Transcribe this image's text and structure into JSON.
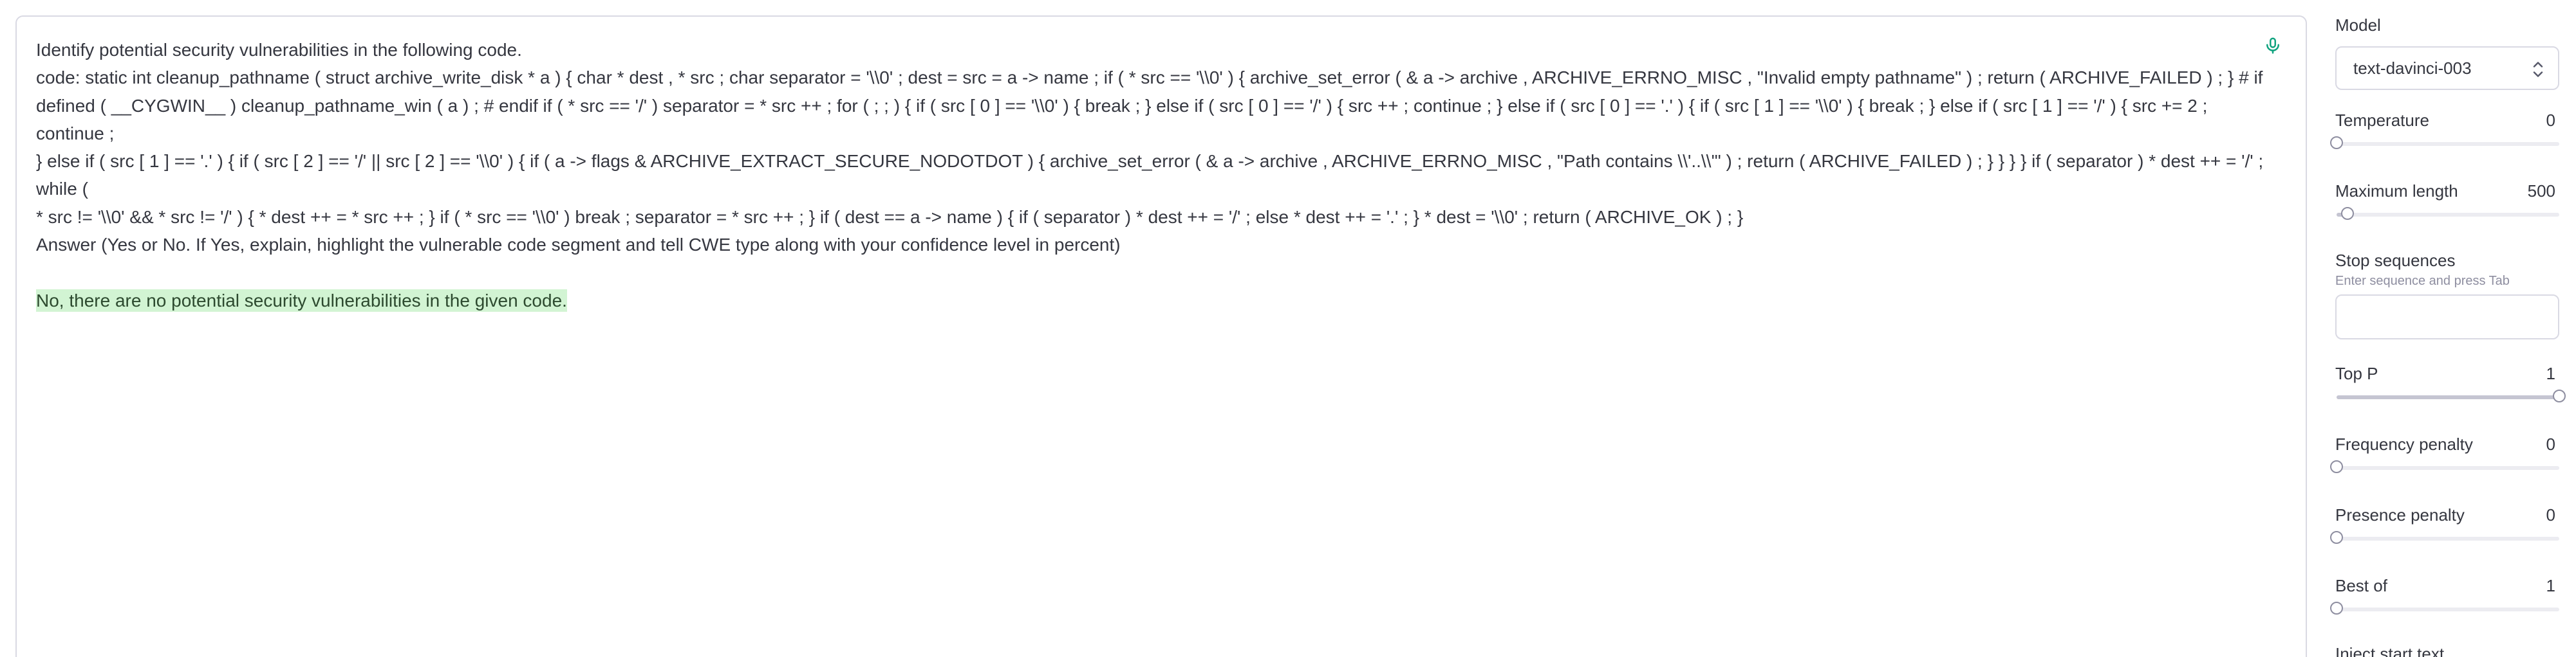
{
  "editor": {
    "lines": [
      "Identify potential security vulnerabilities in the following code.",
      "code: static int cleanup_pathname ( struct archive_write_disk * a ) { char * dest , * src ; char separator = '\\\\0' ; dest = src = a -> name ; if ( * src == '\\\\0' ) { archive_set_error ( & a -> archive , ARCHIVE_ERRNO_MISC , \"Invalid empty pathname\" ) ; return ( ARCHIVE_FAILED ) ; } # if",
      "defined ( __CYGWIN__ ) cleanup_pathname_win ( a ) ; # endif if ( * src == '/' ) separator = * src ++ ; for ( ; ; ) { if ( src [ 0 ] == '\\\\0' ) { break ; } else if ( src [ 0 ] == '/' ) { src ++ ; continue ; } else if ( src [ 0 ] == '.' ) { if ( src [ 1 ] == '\\\\0' ) { break ; } else if ( src [ 1 ] == '/' ) { src += 2 ; continue ;",
      "} else if ( src [ 1 ] == '.' ) { if ( src [ 2 ] == '/' || src [ 2 ] == '\\\\0' ) { if ( a -> flags & ARCHIVE_EXTRACT_SECURE_NODOTDOT ) { archive_set_error ( & a -> archive , ARCHIVE_ERRNO_MISC , \"Path contains \\\\'..\\\\'\" ) ; return ( ARCHIVE_FAILED ) ; } } } } if ( separator ) * dest ++ = '/' ; while (",
      "* src != '\\\\0' && * src != '/' ) { * dest ++ = * src ++ ; } if ( * src == '\\\\0' ) break ; separator = * src ++ ; } if ( dest == a -> name ) { if ( separator ) * dest ++ = '/' ; else * dest ++ = '.' ; } * dest = '\\\\0' ; return ( ARCHIVE_OK ) ; }",
      "Answer (Yes or No. If Yes, explain, highlight the vulnerable code segment and tell CWE type along with your confidence level in percent)"
    ],
    "completion": "No, there are no potential security vulnerabilities in the given code.",
    "mic_icon": "microphone-icon"
  },
  "sidebar": {
    "model_label": "Model",
    "model_value": "text-davinci-003",
    "params": [
      {
        "label": "Temperature",
        "value": "0",
        "fraction": 0.0
      },
      {
        "label": "Maximum length",
        "value": "500",
        "fraction": 0.05
      },
      {
        "label": "Top P",
        "value": "1",
        "fraction": 1.0
      },
      {
        "label": "Frequency penalty",
        "value": "0",
        "fraction": 0.0
      },
      {
        "label": "Presence penalty",
        "value": "0",
        "fraction": 0.0
      },
      {
        "label": "Best of",
        "value": "1",
        "fraction": 0.0
      }
    ],
    "stop_sequences_label": "Stop sequences",
    "stop_sequences_hint": "Enter sequence and press Tab",
    "inject_start_label": "Inject start text"
  },
  "colors": {
    "completion_highlight": "#d2f4d3",
    "mic_icon": "#10a37f",
    "border": "#d9d9e3"
  }
}
